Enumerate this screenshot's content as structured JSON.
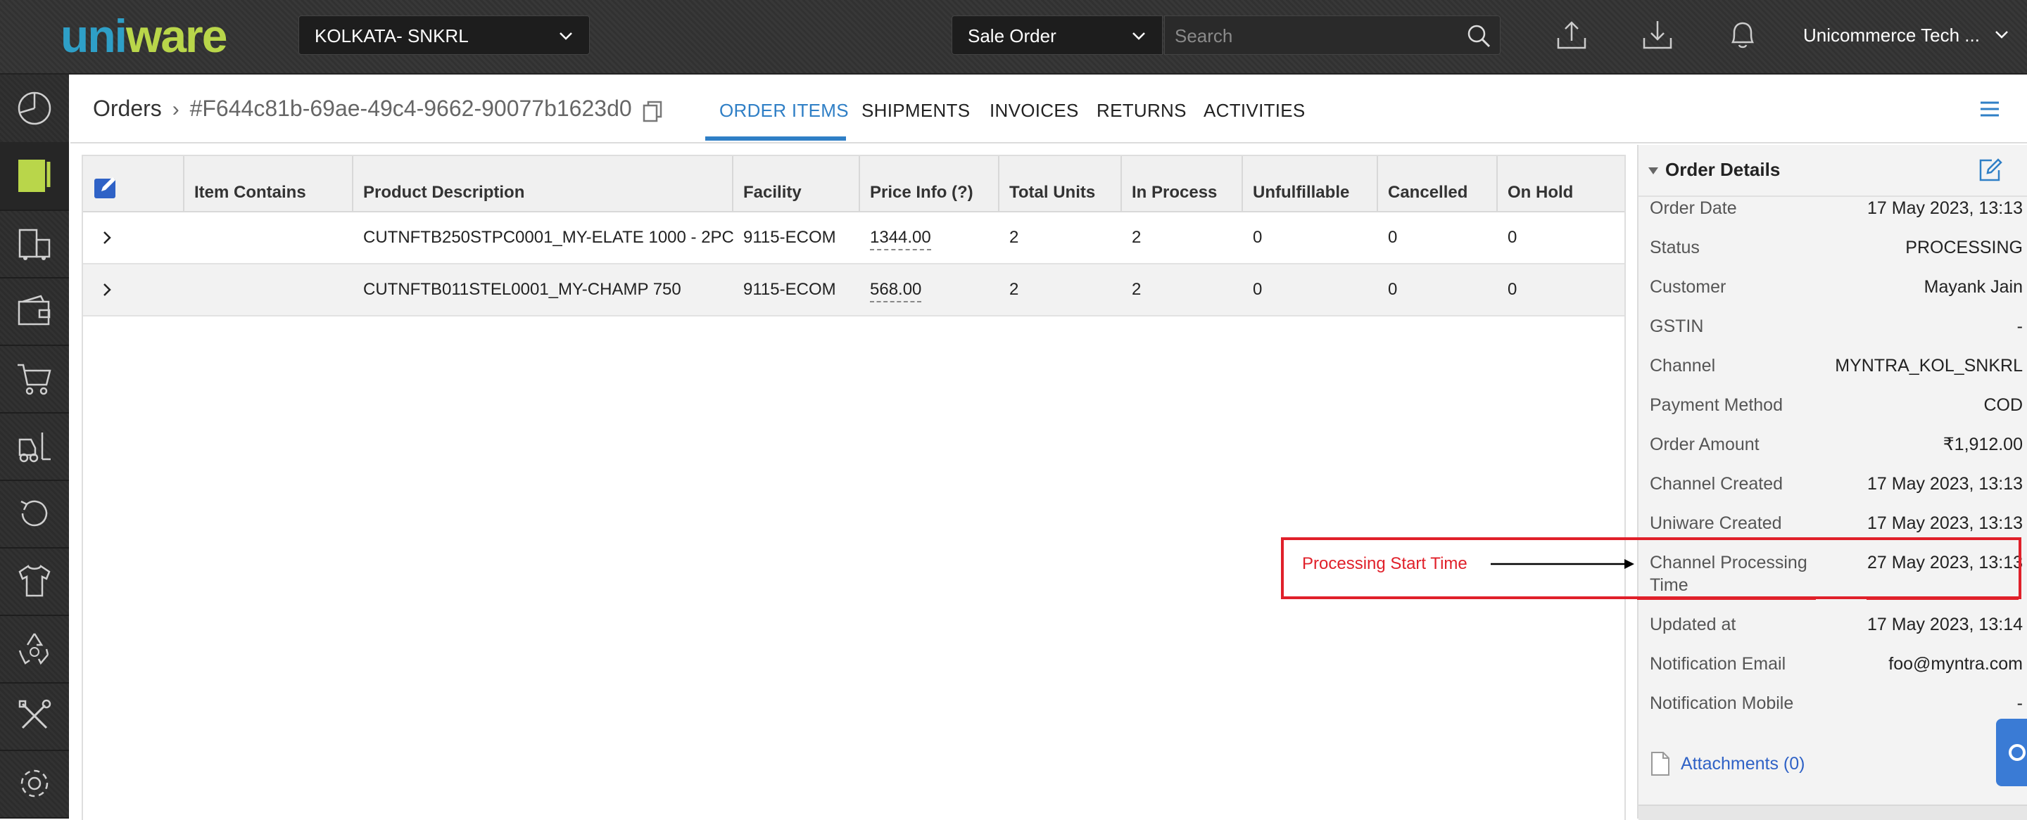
{
  "app": {
    "logo_text": "uniware",
    "facility": "KOLKATA- SNKRL",
    "search_type": "Sale Order",
    "search_placeholder": "Search",
    "user": "Unicommerce Tech ...",
    "icons": [
      "upload-icon",
      "download-icon",
      "bell-icon"
    ]
  },
  "sidebar": {
    "items": [
      {
        "icon": "dashboard-icon"
      },
      {
        "icon": "orders-icon",
        "active": true
      },
      {
        "icon": "shipping-icon"
      },
      {
        "icon": "wallet-icon"
      },
      {
        "icon": "cart-icon"
      },
      {
        "icon": "forklift-icon"
      },
      {
        "icon": "returns-icon"
      },
      {
        "icon": "tshirt-icon"
      },
      {
        "icon": "recycle-icon"
      },
      {
        "icon": "tools-icon"
      },
      {
        "icon": "settings-icon"
      }
    ]
  },
  "header": {
    "breadcrumb_root": "Orders",
    "order_id": "#F644c81b-69ae-49c4-9662-90077b1623d0",
    "tabs": [
      {
        "label": "ORDER ITEMS",
        "active": true
      },
      {
        "label": "SHIPMENTS"
      },
      {
        "label": "INVOICES"
      },
      {
        "label": "RETURNS"
      },
      {
        "label": "ACTIVITIES"
      }
    ]
  },
  "table": {
    "columns": [
      "Item Contains",
      "Product Description",
      "Facility",
      "Price Info (?)",
      "Total Units",
      "In Process",
      "Unfulfillable",
      "Cancelled",
      "On Hold"
    ],
    "rows": [
      {
        "item_contains": "",
        "product": "CUTNFTB250STPC0001_MY-ELATE 1000 - 2PC",
        "facility": "9115-ECOM",
        "price": "1344.00",
        "total": "2",
        "in_process": "2",
        "unfulfillable": "0",
        "cancelled": "0",
        "on_hold": "0"
      },
      {
        "item_contains": "",
        "product": "CUTNFTB011STEL0001_MY-CHAMP 750",
        "facility": "9115-ECOM",
        "price": "568.00",
        "total": "2",
        "in_process": "2",
        "unfulfillable": "0",
        "cancelled": "0",
        "on_hold": "0"
      }
    ]
  },
  "order_details": {
    "title": "Order Details",
    "fields": [
      {
        "label": "Order Date",
        "value": "17 May 2023, 13:13"
      },
      {
        "label": "Status",
        "value": "PROCESSING"
      },
      {
        "label": "Customer",
        "value": "Mayank Jain"
      },
      {
        "label": "GSTIN",
        "value": "-"
      },
      {
        "label": "Channel",
        "value": "MYNTRA_KOL_SNKRL"
      },
      {
        "label": "Payment Method",
        "value": "COD"
      },
      {
        "label": "Order Amount",
        "value": "₹1,912.00"
      },
      {
        "label": "Channel Created",
        "value": "17 May 2023, 13:13"
      },
      {
        "label": "Uniware Created",
        "value": "17 May 2023, 13:13"
      },
      {
        "label": "Channel Processing",
        "label2": "Time",
        "value": "27 May 2023, 13:13"
      },
      {
        "label": "Updated at",
        "value": "17 May 2023, 13:14"
      },
      {
        "label": "Notification Email",
        "value": "foo@myntra.com"
      },
      {
        "label": "Notification Mobile",
        "value": "-"
      }
    ],
    "attachments": "Attachments (0)"
  },
  "annotation": {
    "text": "Processing Start Time",
    "color": "#e0202a"
  },
  "colors": {
    "accent": "#2f7fc6",
    "logo_blue": "#2e9fc7",
    "logo_green": "#b9d64a"
  }
}
